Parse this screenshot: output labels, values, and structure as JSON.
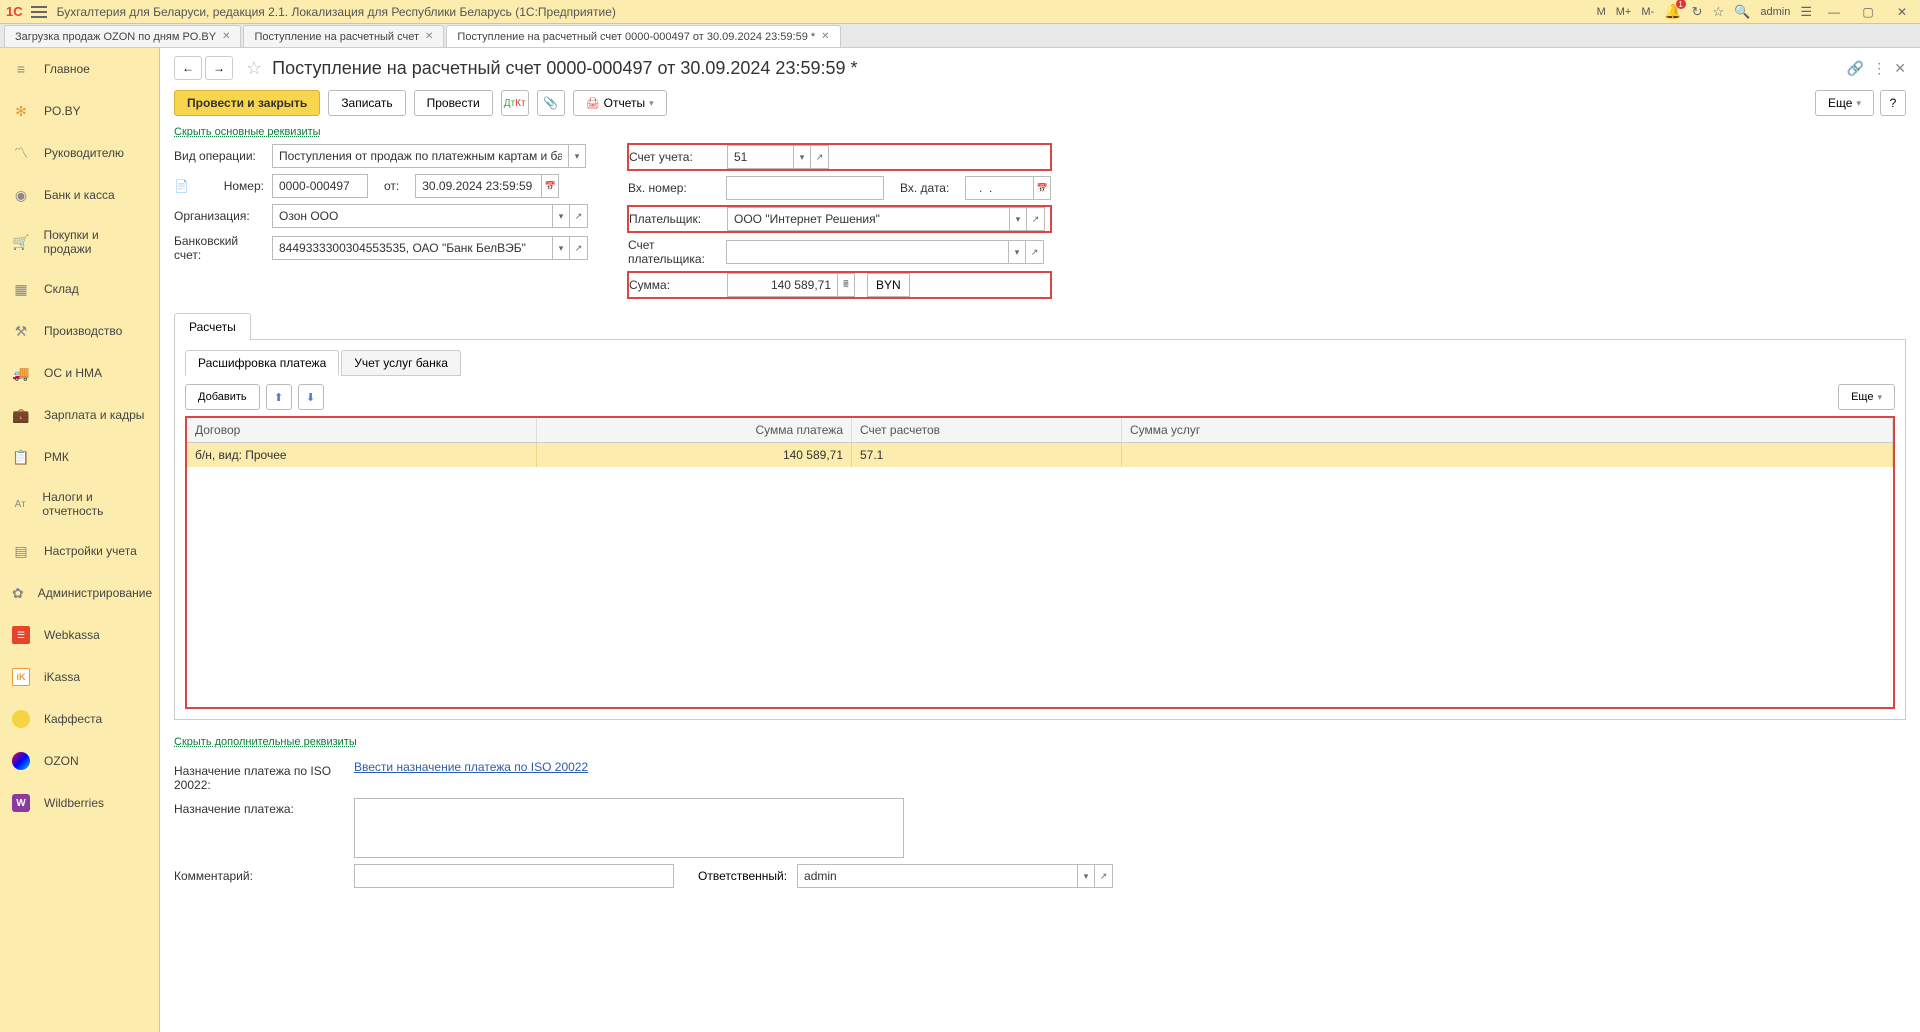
{
  "titlebar": {
    "app_title": "Бухгалтерия для Беларуси, редакция 2.1. Локализация для Республики Беларусь   (1С:Предприятие)",
    "M": "M",
    "Mplus": "M+",
    "Mminus": "M-",
    "bell_badge": "1",
    "user": "admin"
  },
  "tabs": [
    {
      "label": "Загрузка продаж OZON по дням PO.BY"
    },
    {
      "label": "Поступление на расчетный счет"
    },
    {
      "label": "Поступление на расчетный счет 0000-000497 от 30.09.2024 23:59:59 *",
      "active": true
    }
  ],
  "sidebar": {
    "items": [
      {
        "label": "Главное",
        "icon": "≡"
      },
      {
        "label": "PO.BY",
        "icon": "✻",
        "cls": "orange"
      },
      {
        "label": "Руководителю",
        "icon": "↗"
      },
      {
        "label": "Банк и касса",
        "icon": "◉"
      },
      {
        "label": "Покупки и продажи",
        "icon": "🛒"
      },
      {
        "label": "Склад",
        "icon": "▦"
      },
      {
        "label": "Производство",
        "icon": "⚙"
      },
      {
        "label": "ОС и НМА",
        "icon": "🚚"
      },
      {
        "label": "Зарплата и кадры",
        "icon": "💼"
      },
      {
        "label": "РМК",
        "icon": "📋"
      },
      {
        "label": "Налоги и отчетность",
        "icon": "Aт"
      },
      {
        "label": "Настройки учета",
        "icon": "📄"
      },
      {
        "label": "Администрирование",
        "icon": "✿"
      },
      {
        "label": "Webkassa",
        "icon": "☰",
        "cls": "wk"
      },
      {
        "label": "iKassa",
        "icon": "iK",
        "cls": "ik"
      },
      {
        "label": "Каффеста",
        "icon": " ",
        "cls": "yellow-circle"
      },
      {
        "label": "OZON",
        "icon": " ",
        "cls": "ozon"
      },
      {
        "label": "Wildberries",
        "icon": "W",
        "cls": "wb"
      }
    ]
  },
  "doc": {
    "title": "Поступление на расчетный счет 0000-000497 от 30.09.2024 23:59:59 *",
    "toolbar": {
      "post_close": "Провести и закрыть",
      "save": "Записать",
      "post": "Провести",
      "reports": "Отчеты",
      "more": "Еще"
    },
    "hide_main": "Скрыть основные реквизиты",
    "labels": {
      "op_type": "Вид операции:",
      "number": "Номер:",
      "from": "от:",
      "org": "Организация:",
      "bank_acc": "Банковский счет:",
      "acc": "Счет учета:",
      "in_num": "Вх. номер:",
      "in_date": "Вх. дата:",
      "payer": "Плательщик:",
      "payer_acc": "Счет плательщика:",
      "sum": "Сумма:"
    },
    "fields": {
      "op_type": "Поступления от продаж по платежным картам и банковским кр",
      "number": "0000-000497",
      "date": "30.09.2024 23:59:59",
      "org": "Озон ООО",
      "bank_acc": "8449333300304553535, ОАО \"Банк БелВЭБ\"",
      "acc": "51",
      "in_num": "",
      "in_date": "  .  .    ",
      "payer": "ООО \"Интернет Решения\"",
      "payer_acc": "",
      "sum": "140 589,71",
      "currency": "BYN"
    },
    "tab1": "Расчеты",
    "subtab1": "Расшифровка платежа",
    "subtab2": "Учет услуг банка",
    "add": "Добавить",
    "more2": "Еще",
    "grid": {
      "headers": [
        "Договор",
        "Сумма платежа",
        "Счет расчетов",
        "Сумма услуг"
      ],
      "row": [
        "б/н, вид: Прочее",
        "140 589,71",
        "57.1",
        ""
      ]
    },
    "hide_extra": "Скрыть дополнительные реквизиты",
    "iso_lbl": "Назначение платежа по ISO 20022:",
    "iso_link": "Ввести назначение платежа по ISO 20022",
    "purpose_lbl": "Назначение платежа:",
    "purpose": "",
    "comment_lbl": "Комментарий:",
    "comment": "",
    "resp_lbl": "Ответственный:",
    "resp": "admin"
  }
}
